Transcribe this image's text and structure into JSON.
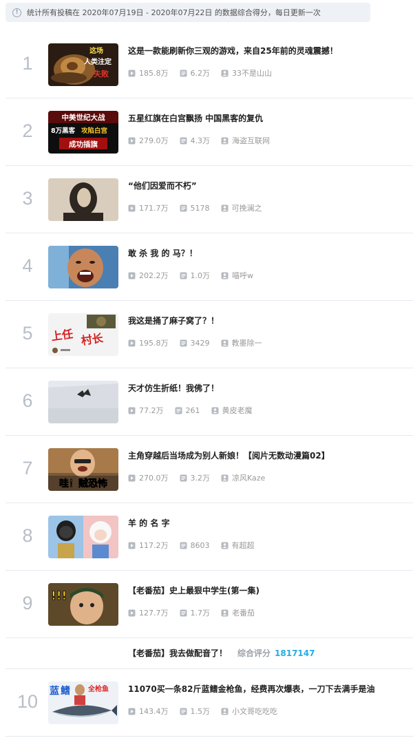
{
  "notice": {
    "text": "统计所有投稿在 2020年07月19日 - 2020年07月22日 的数据综合得分，每日更新一次"
  },
  "items": [
    {
      "rank": "1",
      "title": "这是一款能刷新你三观的游戏，来自25年前的灵魂震撼！",
      "plays": "185.8万",
      "danmaku": "6.2万",
      "author": "33不是山山",
      "thumb_text": [
        "这场",
        "人类注定",
        "失败"
      ]
    },
    {
      "rank": "2",
      "title": "五星红旗在白宫飘扬 中国黑客的复仇",
      "plays": "279.0万",
      "danmaku": "4.3万",
      "author": "海盗互联网",
      "thumb_text": [
        "中美世纪大战",
        "8万黑客",
        "攻陷白宫",
        "成功插旗"
      ]
    },
    {
      "rank": "3",
      "title": "“他们因爱而不朽”",
      "plays": "171.7万",
      "danmaku": "5178",
      "author": "可挽澜之",
      "thumb_text": []
    },
    {
      "rank": "4",
      "title": "敢 杀 我 的 马？！",
      "plays": "202.2万",
      "danmaku": "1.0万",
      "author": "喵呼w",
      "thumb_text": []
    },
    {
      "rank": "5",
      "title": "我这是捅了麻子窝了？！",
      "plays": "195.8万",
      "danmaku": "3429",
      "author": "教墨除一",
      "thumb_text": [
        "上任",
        "村长"
      ]
    },
    {
      "rank": "6",
      "title": "天才仿生折纸！我佛了！",
      "plays": "77.2万",
      "danmaku": "261",
      "author": "黄皮老魔",
      "thumb_text": []
    },
    {
      "rank": "7",
      "title": "主角穿越后当场成为别人新娘！【阅片无数动漫篇02】",
      "plays": "270.0万",
      "danmaku": "3.2万",
      "author": "凉风Kaze",
      "thumb_text": [
        "哇！贼恐怖"
      ]
    },
    {
      "rank": "8",
      "title": "羊 的 名 字",
      "plays": "117.2万",
      "danmaku": "8603",
      "author": "有超超",
      "thumb_text": []
    },
    {
      "rank": "9",
      "title": "【老番茄】史上最狠中学生(第一集)",
      "plays": "127.7万",
      "danmaku": "1.7万",
      "author": "老番茄",
      "thumb_text": [
        "!!!"
      ]
    },
    {
      "rank": "10",
      "title": "11070买一条82斤蓝鳍金枪鱼，经费再次爆表，一刀下去满手是油",
      "plays": "143.4万",
      "danmaku": "1.5万",
      "author": "小文哥吃吃吃",
      "thumb_text": [
        "蓝",
        "鳍",
        "全枪鱼"
      ]
    }
  ],
  "related": {
    "title": "【老番茄】我去做配音了！",
    "score_label": "综合评分",
    "score_value": "1817147"
  },
  "icons": {
    "info": "info-circle-icon",
    "play": "play-count-icon",
    "danmaku": "danmaku-icon",
    "author": "up-author-icon"
  },
  "colors": {
    "rank_number": "#b7bec6",
    "score": "#23ade5",
    "meta_text": "#999999",
    "divider": "#e5e9ef"
  }
}
